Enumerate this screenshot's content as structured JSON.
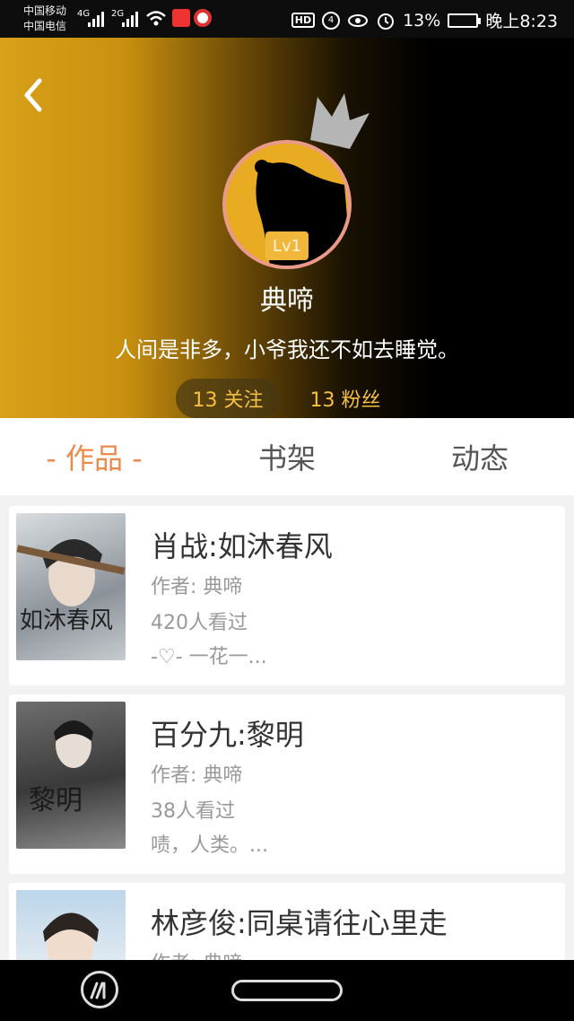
{
  "statusbar": {
    "carrier1": "中国移动",
    "carrier2": "中国电信",
    "net1": "4G",
    "net2": "2G",
    "hd": "HD",
    "battery_pct": "13%",
    "time": "晚上8:23"
  },
  "profile": {
    "level": "Lv1",
    "name": "典啼",
    "bio": "人间是非多，小爷我还不如去睡觉。",
    "following": "13 关注",
    "fans": "13 粉丝"
  },
  "tabs": [
    {
      "label": "- 作品 -",
      "active": true
    },
    {
      "label": "书架",
      "active": false
    },
    {
      "label": "动态",
      "active": false
    }
  ],
  "works": [
    {
      "title": "肖战:如沐春风",
      "author": "作者: 典啼",
      "views": "420人看过",
      "excerpt": "-♡- 一花一...",
      "cover_text": "如沐春风"
    },
    {
      "title": "百分九:黎明",
      "author": "作者: 典啼",
      "views": "38人看过",
      "excerpt": "啧，人类。...",
      "cover_text": "黎明"
    },
    {
      "title": "林彦俊:同桌请往心里走",
      "author": "作者: 典啼",
      "views": "",
      "excerpt": "",
      "cover_text": ""
    }
  ],
  "colors": {
    "accent": "#ec8a4b",
    "gold": "#f3c042",
    "header_left": "#d9a019"
  },
  "icons": [
    "back-icon",
    "crown-icon",
    "eye-icon",
    "alarm-icon",
    "wifi-icon"
  ]
}
